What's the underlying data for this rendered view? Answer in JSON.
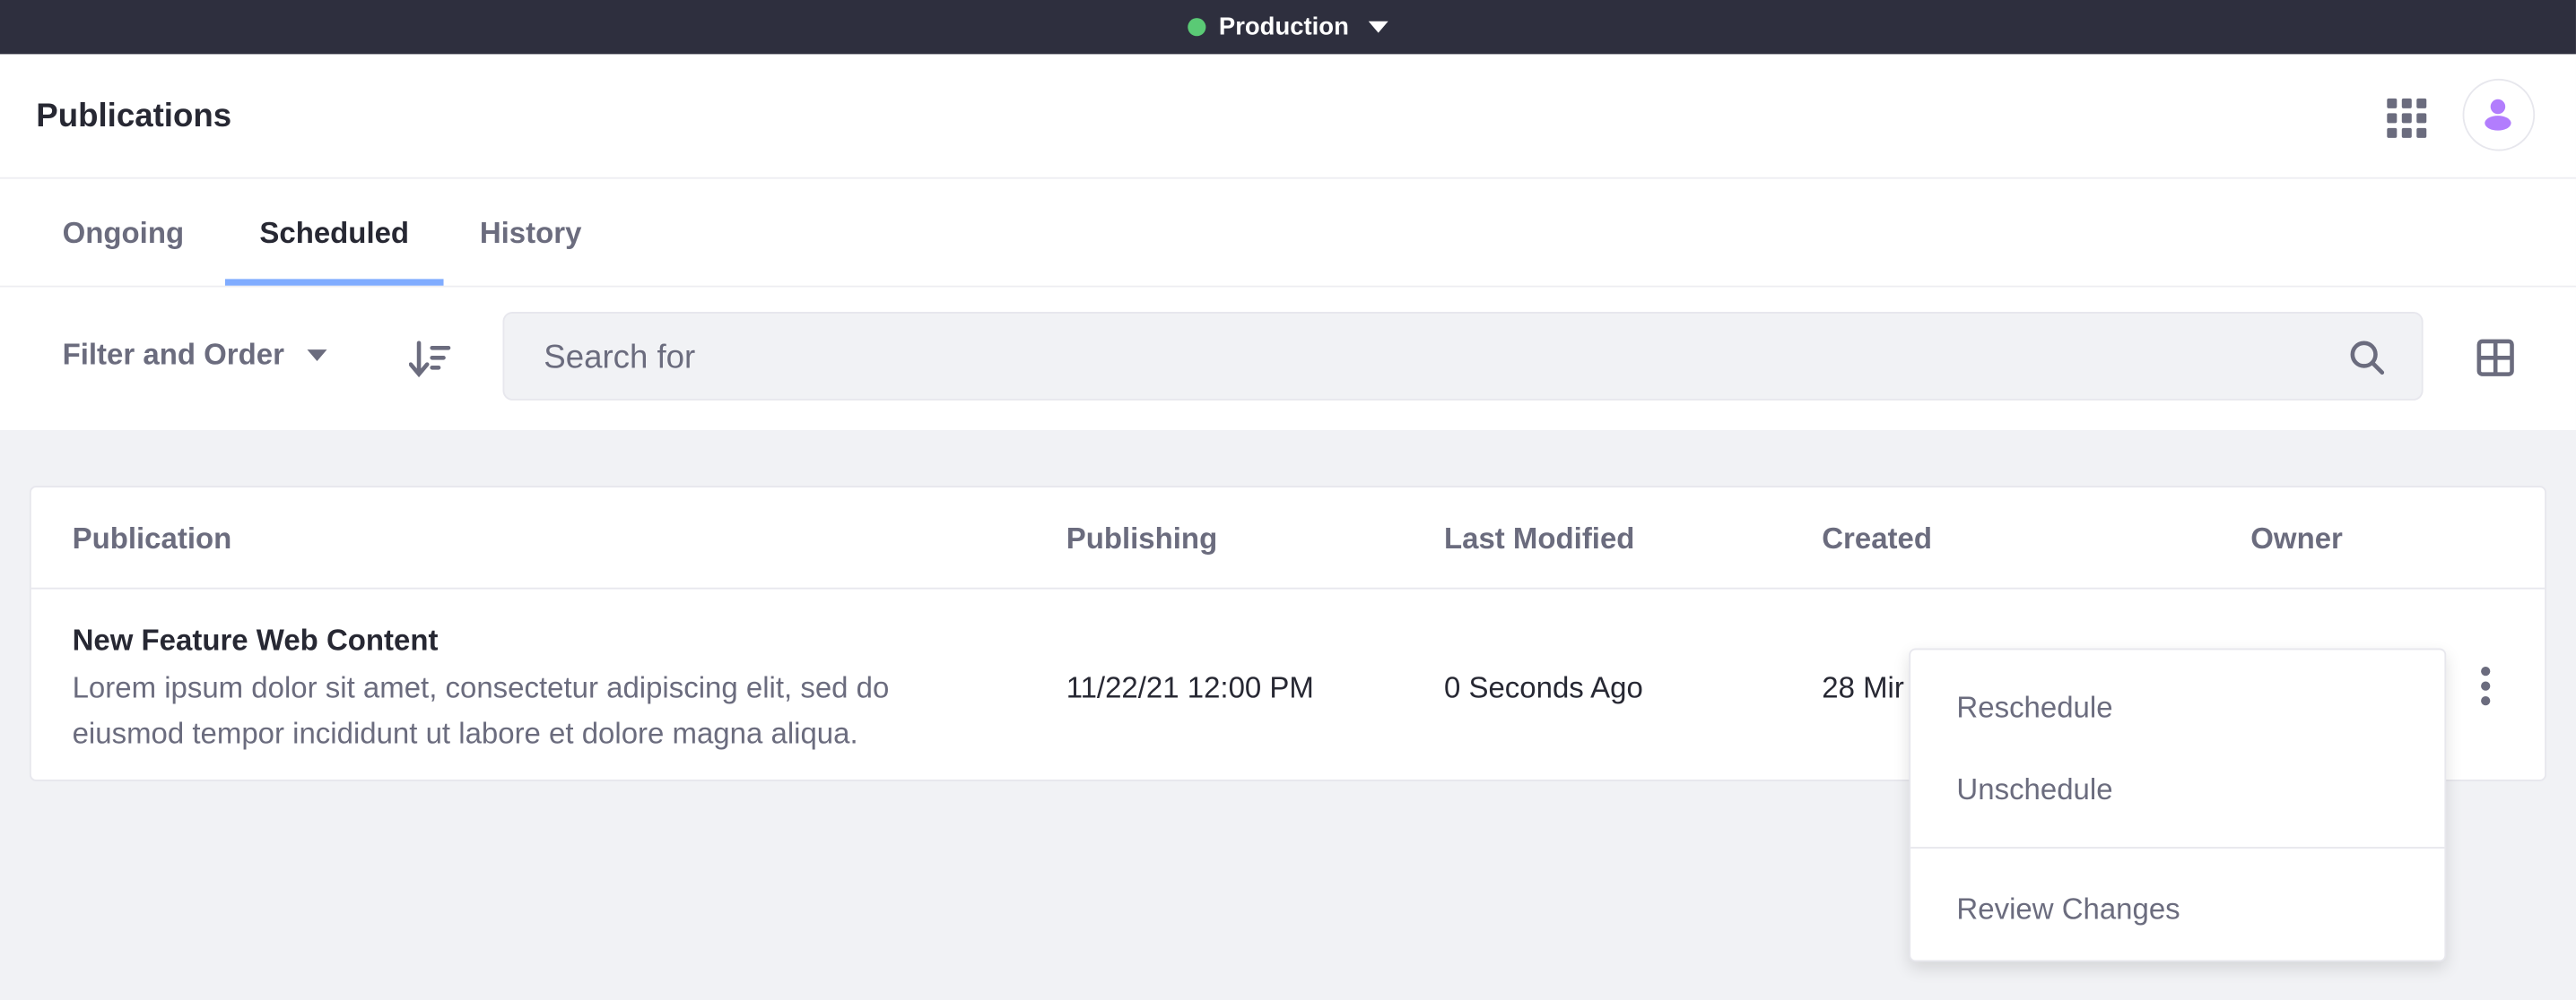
{
  "topbar": {
    "environment": "Production",
    "status_color": "#5aca75"
  },
  "header": {
    "title": "Publications",
    "apps_icon": "apps-grid-icon",
    "avatar_icon": "user-icon",
    "avatar_color": "#b27dfd"
  },
  "tabs": [
    {
      "label": "Ongoing"
    },
    {
      "label": "Scheduled",
      "active": true
    },
    {
      "label": "History"
    }
  ],
  "toolbar": {
    "filter_label": "Filter and Order",
    "search_placeholder": "Search for",
    "search_value": ""
  },
  "table": {
    "columns": [
      "Publication",
      "Publishing",
      "Last Modified",
      "Created",
      "Owner"
    ],
    "rows": [
      {
        "title": "New Feature Web Content",
        "description": "Lorem ipsum dolor sit amet, consectetur adipiscing elit, sed do eiusmod tempor incididunt ut labore et dolore magna aliqua.",
        "publishing": "11/22/21 12:00 PM",
        "last_modified": "0 Seconds Ago",
        "created": "28 Mir"
      }
    ]
  },
  "menu": {
    "items": [
      "Reschedule",
      "Unschedule",
      "Review Changes"
    ]
  }
}
